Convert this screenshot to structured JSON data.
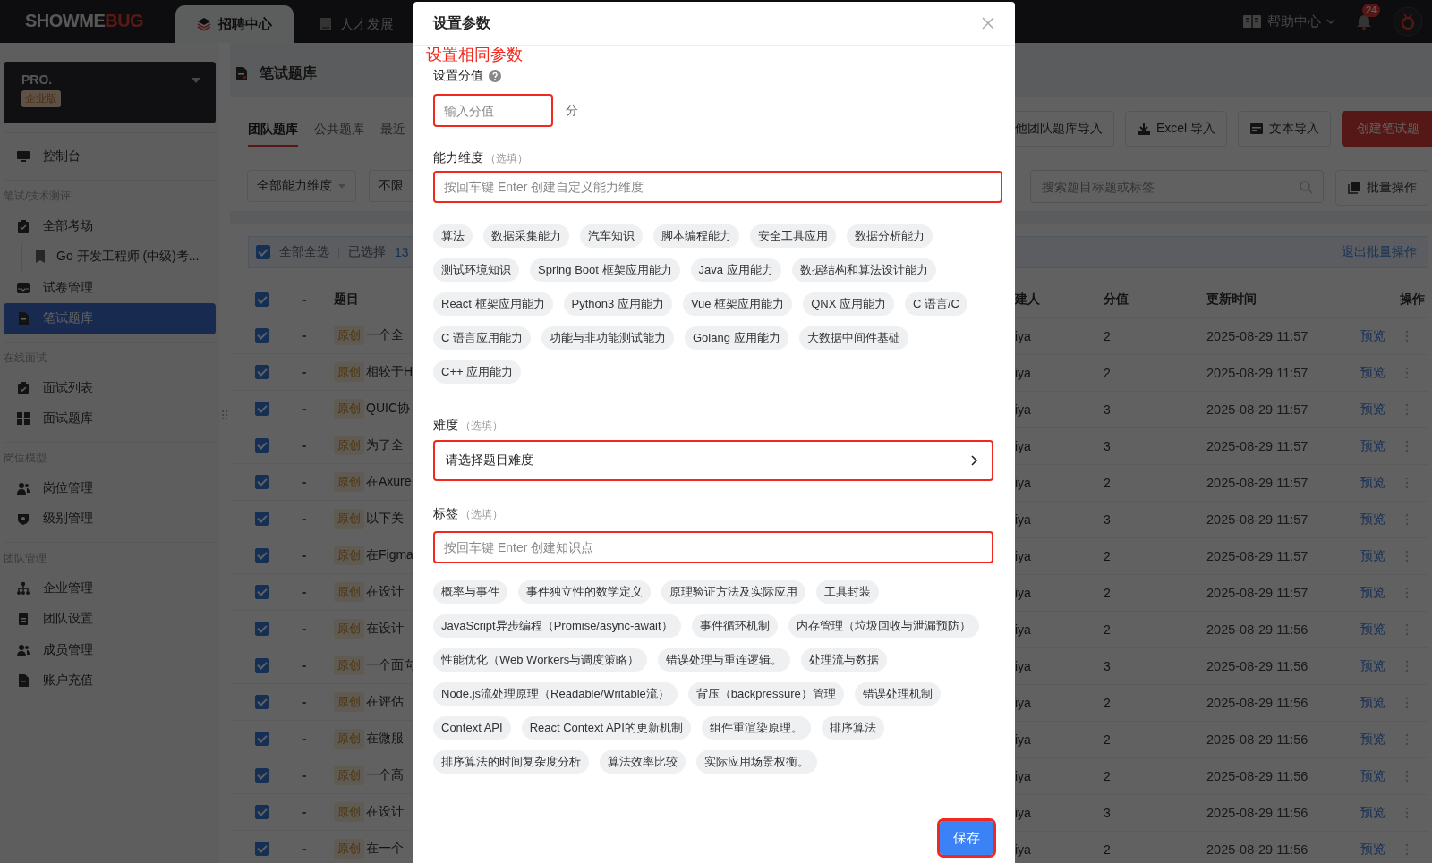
{
  "topbar": {
    "logo": {
      "part_1": "SHOWME",
      "part_2": "BUG"
    },
    "tabs": [
      {
        "label": "招聘中心",
        "selected": true
      },
      {
        "label": "人才发展",
        "selected": false
      }
    ],
    "help": "帮助中心",
    "notification_count": "24"
  },
  "sidebar": {
    "plan": {
      "name": "PRO.",
      "edition": "企业版"
    },
    "top_items": [
      {
        "label": "控制台",
        "selected": false
      }
    ],
    "groups": [
      {
        "title": "笔试/技术测评",
        "items": [
          {
            "label": "全部考场",
            "selected": false,
            "children": [
              {
                "label": "Go 开发工程师 (中级)考...",
                "selected": false
              }
            ]
          },
          {
            "label": "试卷管理",
            "selected": false
          },
          {
            "label": "笔试题库",
            "selected": true
          }
        ]
      },
      {
        "title": "在线面试",
        "items": [
          {
            "label": "面试列表",
            "selected": false
          },
          {
            "label": "面试题库",
            "selected": false
          }
        ]
      },
      {
        "title": "岗位模型",
        "items": [
          {
            "label": "岗位管理",
            "selected": false
          },
          {
            "label": "级别管理",
            "selected": false
          }
        ]
      },
      {
        "title": "团队管理",
        "items": [
          {
            "label": "企业管理",
            "selected": false
          },
          {
            "label": "团队设置",
            "selected": false
          },
          {
            "label": "成员管理",
            "selected": false
          },
          {
            "label": "账户充值",
            "selected": false
          }
        ]
      }
    ]
  },
  "page": {
    "title": "笔试题库",
    "tabs": [
      {
        "label": "团队题库",
        "selected": true
      },
      {
        "label": "公共题库",
        "selected": false
      },
      {
        "label": "最近",
        "selected": false
      }
    ],
    "actions": [
      {
        "label": "他团队题库导入",
        "kind": "plain"
      },
      {
        "label": "Excel 导入",
        "kind": "download"
      },
      {
        "label": "文本导入",
        "kind": "text"
      },
      {
        "label": "创建笔试题",
        "kind": "primary"
      }
    ],
    "filters": [
      {
        "label": "全部能力维度",
        "kind": "dropdown"
      },
      {
        "label": "不限",
        "kind": "plain"
      }
    ],
    "search_placeholder": "搜索题目标题或标签",
    "bulk": "批量操作",
    "selection": {
      "all_checked": true,
      "select_all": "全部全选",
      "selected_label": "已选择",
      "selected_count": "13",
      "exit": "退出批量操作"
    },
    "table": {
      "header_checked": true,
      "columns": [
        "-",
        "题目",
        "建人",
        "分值",
        "更新时间",
        "操作"
      ],
      "rows": [
        {
          "checked": true,
          "dash": "-",
          "tag": "原创",
          "title": "一个全",
          "creator": "iya",
          "score": "2",
          "updated": "2025-08-29 11:57",
          "action": "预览"
        },
        {
          "checked": true,
          "dash": "-",
          "tag": "原创",
          "title": "相较于H",
          "creator": "iya",
          "score": "2",
          "updated": "2025-08-29 11:57",
          "action": "预览"
        },
        {
          "checked": true,
          "dash": "-",
          "tag": "原创",
          "title": "QUIC协",
          "creator": "iya",
          "score": "3",
          "updated": "2025-08-29 11:57",
          "action": "预览"
        },
        {
          "checked": true,
          "dash": "-",
          "tag": "原创",
          "title": "为了全",
          "creator": "iya",
          "score": "3",
          "updated": "2025-08-29 11:57",
          "action": "预览"
        },
        {
          "checked": true,
          "dash": "-",
          "tag": "原创",
          "title": "在Axure",
          "creator": "iya",
          "score": "2",
          "updated": "2025-08-29 11:57",
          "action": "预览"
        },
        {
          "checked": true,
          "dash": "-",
          "tag": "原创",
          "title": "以下关",
          "creator": "iya",
          "score": "3",
          "updated": "2025-08-29 11:57",
          "action": "预览"
        },
        {
          "checked": true,
          "dash": "-",
          "tag": "原创",
          "title": "在Figma",
          "creator": "iya",
          "score": "2",
          "updated": "2025-08-29 11:57",
          "action": "预览"
        },
        {
          "checked": true,
          "dash": "-",
          "tag": "原创",
          "title": "在设计",
          "creator": "iya",
          "score": "2",
          "updated": "2025-08-29 11:57",
          "action": "预览"
        },
        {
          "checked": true,
          "dash": "-",
          "tag": "原创",
          "title": "在设计",
          "creator": "iya",
          "score": "2",
          "updated": "2025-08-29 11:56",
          "action": "预览"
        },
        {
          "checked": true,
          "dash": "-",
          "tag": "原创",
          "title": "一个面向",
          "creator": "iya",
          "score": "3",
          "updated": "2025-08-29 11:56",
          "action": "预览"
        },
        {
          "checked": true,
          "dash": "-",
          "tag": "原创",
          "title": "在评估",
          "creator": "iya",
          "score": "2",
          "updated": "2025-08-29 11:56",
          "action": "预览"
        },
        {
          "checked": true,
          "dash": "-",
          "tag": "原创",
          "title": "在微服",
          "creator": "iya",
          "score": "2",
          "updated": "2025-08-29 11:56",
          "action": "预览"
        },
        {
          "checked": true,
          "dash": "-",
          "tag": "原创",
          "title": "一个高",
          "creator": "iya",
          "score": "2",
          "updated": "2025-08-29 11:56",
          "action": "预览"
        },
        {
          "checked": true,
          "dash": "-",
          "tag": "原创",
          "title": "在设计",
          "creator": "iya",
          "score": "3",
          "updated": "2025-08-29 11:56",
          "action": "预览"
        },
        {
          "checked": true,
          "dash": "-",
          "tag": "原创",
          "title": "在一个",
          "creator": "iya",
          "score": "2",
          "updated": "2025-08-29 11:56",
          "action": "预览"
        }
      ]
    }
  },
  "modal": {
    "title": "设置参数",
    "annotation": "设置相同参数",
    "score": {
      "label": "设置分值",
      "placeholder": "输入分值",
      "unit": "分",
      "highlighted": true
    },
    "ability": {
      "label": "能力维度",
      "optional": "（选填）",
      "placeholder": "按回车键 Enter 创建自定义能力维度",
      "highlighted": true,
      "tag_rows": [
        [
          "算法",
          "数据采集能力",
          "汽车知识",
          "脚本编程能力",
          "安全工具应用",
          "数据分析能力"
        ],
        [
          "测试环境知识",
          "Spring Boot 框架应用能力",
          "Java 应用能力",
          "数据结构和算法设计能力"
        ],
        [
          "React 框架应用能力",
          "Python3 应用能力",
          "Vue 框架应用能力",
          "QNX 应用能力",
          "C 语言/C"
        ],
        [
          "C 语言应用能力",
          "功能与非功能测试能力",
          "Golang 应用能力",
          "大数据中间件基础"
        ],
        [
          "C++ 应用能力"
        ]
      ]
    },
    "difficulty": {
      "label": "难度",
      "optional": "（选填）",
      "value": "请选择题目难度",
      "highlighted": true
    },
    "tags": {
      "label": "标签",
      "optional": "（选填）",
      "placeholder": "按回车键 Enter 创建知识点",
      "highlighted": true,
      "tag_rows": [
        [
          "概率与事件",
          "事件独立性的数学定义",
          "原理验证方法及实际应用",
          "工具封装"
        ],
        [
          "JavaScript异步编程（Promise/async-await）",
          "事件循环机制",
          "内存管理（垃圾回收与泄漏预防）"
        ],
        [
          "性能优化（Web Workers与调度策略）",
          "错误处理与重连逻辑。",
          "处理流与数据"
        ],
        [
          "Node.js流处理原理（Readable/Writable流）",
          "背压（backpressure）管理",
          "错误处理机制"
        ],
        [
          "Context API",
          "React Context API的更新机制",
          "组件重渲染原理。",
          "排序算法"
        ],
        [
          "排序算法的时间复杂度分析",
          "算法效率比较",
          "实际应用场景权衡。"
        ]
      ]
    },
    "save": {
      "label": "保存",
      "highlighted": true
    }
  }
}
